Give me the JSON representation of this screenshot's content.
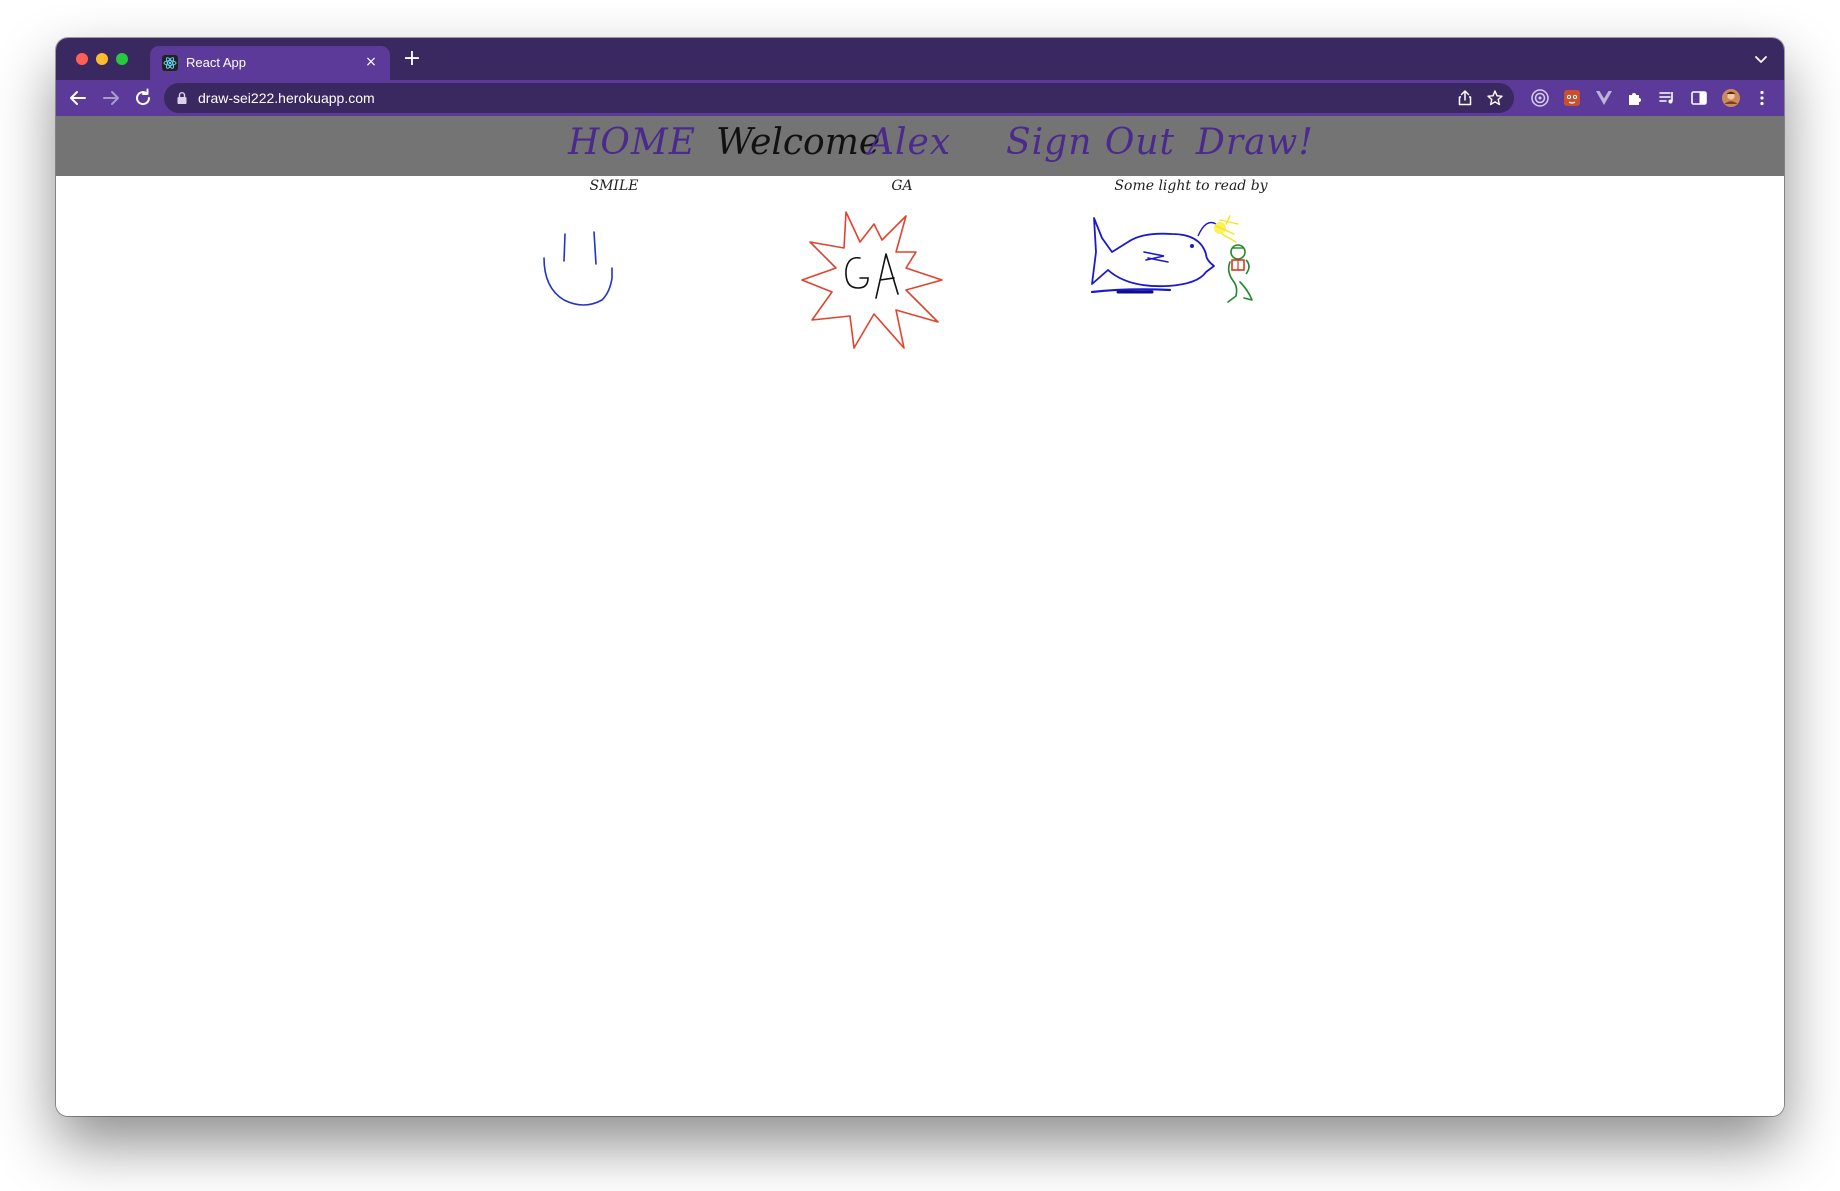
{
  "browser": {
    "tab": {
      "title": "React App",
      "close_glyph": "×",
      "favicon": "react-logo-icon"
    },
    "new_tab_glyph": "+",
    "url": "draw-sei222.herokuapp.com",
    "colors": {
      "tabstrip": "#3a2860",
      "toolbar": "#5b3a9a",
      "omnibox": "#3a2860"
    }
  },
  "site": {
    "nav": {
      "home_label": "HOME",
      "welcome_label": "Welcome",
      "user_name": "Alex",
      "signout_label": "Sign Out",
      "draw_label": "Draw!"
    },
    "colors": {
      "nav_bar": "#747474",
      "nav_link": "#4a2a8c"
    },
    "drawings": [
      {
        "title": "SMILE",
        "stroke_color": "#2233cc"
      },
      {
        "title": "GA",
        "stroke_color": "#e0442e"
      },
      {
        "title": "Some light to read by",
        "stroke_color": "#1a1acc"
      }
    ]
  }
}
